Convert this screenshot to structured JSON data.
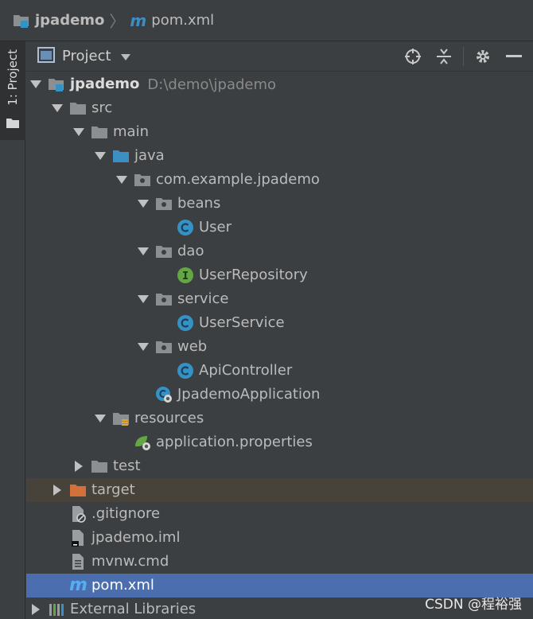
{
  "breadcrumb": {
    "project": "jpademo",
    "file": "pom.xml"
  },
  "tool_strip": {
    "tab_label": "1: Project"
  },
  "panel": {
    "title": "Project"
  },
  "tree": {
    "root": {
      "label": "jpademo",
      "path": "D:\\demo\\jpademo"
    },
    "src": "src",
    "main": "main",
    "java": "java",
    "package": "com.example.jpademo",
    "beans": "beans",
    "user": "User",
    "dao": "dao",
    "user_repository": "UserRepository",
    "service": "service",
    "user_service": "UserService",
    "web": "web",
    "api_controller": "ApiController",
    "app": "JpademoApplication",
    "resources": "resources",
    "app_props": "application.properties",
    "test": "test",
    "target": "target",
    "gitignore": ".gitignore",
    "iml": "jpademo.iml",
    "mvnw": "mvnw.cmd",
    "pom": "pom.xml",
    "ext_libs": "External Libraries"
  },
  "watermark": "CSDN @程裕强",
  "colors": {
    "selection": "#4b6eaf",
    "excluded": "#47433a",
    "class_icon": "#3592c4",
    "interface_icon": "#62a744",
    "folder": "#8b8f92",
    "source_folder": "#3b8fc4",
    "excluded_folder": "#d4703a"
  }
}
